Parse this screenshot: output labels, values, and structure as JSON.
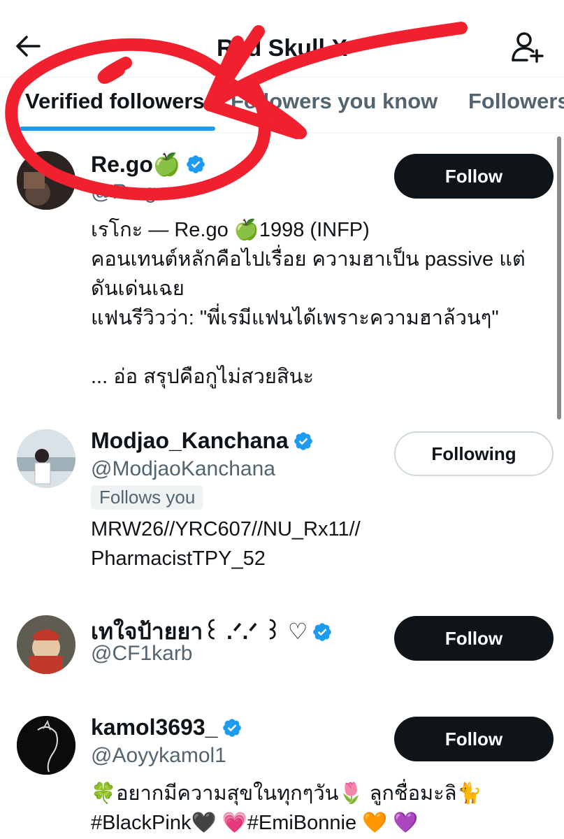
{
  "header": {
    "title": "Red Skull X"
  },
  "tabs": [
    {
      "label": "Verified followers"
    },
    {
      "label": "Followers you know"
    },
    {
      "label": "Followers"
    }
  ],
  "users": [
    {
      "name": "Re.go🍏",
      "handle": "@Re.go",
      "follows_you": "",
      "bio": "เรโกะ — Re.go 🍏1998 (INFP)\nคอนเทนต์หลักคือไปเรื่อย ความฮาเป็น passive แต่ดันเด่นเฉย\nแฟนรีวิวว่า: \"พี่เรมีแฟนได้เพราะความฮาล้วนๆ\"\n\n... อ่อ สรุปคือกูไม่สวยสินะ",
      "button": "Follow",
      "avatar_color": "#3b2f2a"
    },
    {
      "name": "Modjao_Kanchana",
      "handle": "@ModjaoKanchana",
      "follows_you": "Follows you",
      "bio": "MRW26//YRC607//NU_Rx11//\nPharmacistTPY_52",
      "button": "Following",
      "avatar_color": "#cfd8dc"
    },
    {
      "name": "เทใจป้ายยา꒰ .ᐟ.ᐟ ꒱ ♡",
      "handle": "@CF1karb",
      "follows_you": "",
      "bio": "",
      "button": "Follow",
      "avatar_color": "#6d6a5e"
    },
    {
      "name": "kamol3693_",
      "handle": "@Aoyykamol1",
      "follows_you": "",
      "bio": "🍀อยากมีความสุขในทุกๆวัน🌷 ลูกชื่อมะลิ🐈\n#BlackPink🖤 💗#EmiBonnie 🧡 💜",
      "button": "Follow",
      "avatar_color": "#111111"
    }
  ],
  "colors": {
    "accent": "#1d9bf0",
    "annotation": "#f0202e"
  }
}
